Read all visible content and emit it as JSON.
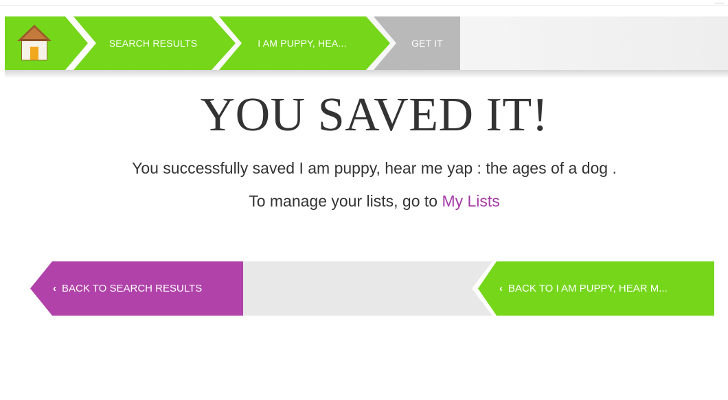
{
  "breadcrumb": {
    "home_icon": "house-icon",
    "items": [
      {
        "label": "SEARCH RESULTS"
      },
      {
        "label": "I AM PUPPY, HEA..."
      },
      {
        "label": "GET IT"
      }
    ],
    "colors": {
      "active": "#75d61a",
      "inactive": "#b9b9b9"
    }
  },
  "main": {
    "title": "YOU SAVED IT!",
    "message_prefix": "You successfully saved I am puppy, hear me yap : the ages of a dog .",
    "manage_prefix": "To manage your lists, go to ",
    "manage_link": "My Lists"
  },
  "nav": {
    "back_search": "BACK TO SEARCH RESULTS",
    "back_item": "BACK TO I AM PUPPY, HEAR M...",
    "chevron_icon": "chevron-left-icon",
    "colors": {
      "search": "#b042aa",
      "item": "#75d61a"
    }
  }
}
